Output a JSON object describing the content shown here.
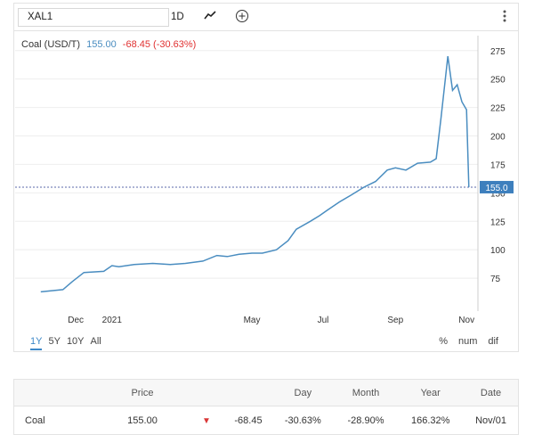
{
  "toolbar": {
    "symbol": "XAL1",
    "interval": "1D"
  },
  "legend": {
    "name": "Coal (USD/T)",
    "price": "155.00",
    "change": "-68.45 (-30.63%)"
  },
  "chart_data": {
    "type": "line",
    "series": [
      {
        "values": [
          [
            "2020-11-01",
            63
          ],
          [
            "2020-11-20",
            65
          ],
          [
            "2020-11-28",
            72
          ],
          [
            "2020-12-08",
            80
          ],
          [
            "2020-12-25",
            81
          ],
          [
            "2021-01-01",
            86
          ],
          [
            "2021-01-07",
            85
          ],
          [
            "2021-01-20",
            87
          ],
          [
            "2021-02-05",
            88
          ],
          [
            "2021-02-20",
            87
          ],
          [
            "2021-03-05",
            88
          ],
          [
            "2021-03-20",
            90
          ],
          [
            "2021-04-01",
            95
          ],
          [
            "2021-04-10",
            94
          ],
          [
            "2021-04-20",
            96
          ],
          [
            "2021-05-01",
            97
          ],
          [
            "2021-05-10",
            97
          ],
          [
            "2021-05-22",
            100
          ],
          [
            "2021-06-01",
            108
          ],
          [
            "2021-06-08",
            118
          ],
          [
            "2021-06-20",
            125
          ],
          [
            "2021-06-28",
            130
          ],
          [
            "2021-07-05",
            135
          ],
          [
            "2021-07-15",
            142
          ],
          [
            "2021-07-25",
            148
          ],
          [
            "2021-08-05",
            155
          ],
          [
            "2021-08-15",
            160
          ],
          [
            "2021-08-25",
            170
          ],
          [
            "2021-09-01",
            172
          ],
          [
            "2021-09-10",
            170
          ],
          [
            "2021-09-20",
            176
          ],
          [
            "2021-10-01",
            177
          ],
          [
            "2021-10-06",
            180
          ],
          [
            "2021-10-10",
            215
          ],
          [
            "2021-10-16",
            270
          ],
          [
            "2021-10-20",
            240
          ],
          [
            "2021-10-24",
            245
          ],
          [
            "2021-10-28",
            230
          ],
          [
            "2021-11-01",
            223
          ],
          [
            "2021-11-03",
            155
          ]
        ]
      }
    ],
    "x_labels": [
      "Dec",
      "2021",
      "May",
      "Jul",
      "Sep",
      "Nov"
    ],
    "y_ticks": [
      75,
      100,
      125,
      150,
      175,
      200,
      225,
      250,
      275
    ],
    "ylim": [
      50,
      285
    ],
    "last_value_label": "155.0",
    "grid": true
  },
  "ranges": [
    "1Y",
    "5Y",
    "10Y",
    "All"
  ],
  "active_range": "1Y",
  "modes": [
    "%",
    "num",
    "dif"
  ],
  "quote_table": {
    "headers": [
      "",
      "Price",
      "",
      "",
      "Day",
      "Month",
      "Year",
      "Date"
    ],
    "row": {
      "name": "Coal",
      "price": "155.00",
      "change": "-68.45",
      "day": "-30.63%",
      "month": "-28.90%",
      "year": "166.32%",
      "date": "Nov/01"
    }
  },
  "colors": {
    "line": "#4a8dc0",
    "accent": "#3d88c8",
    "negative": "#e03131"
  }
}
